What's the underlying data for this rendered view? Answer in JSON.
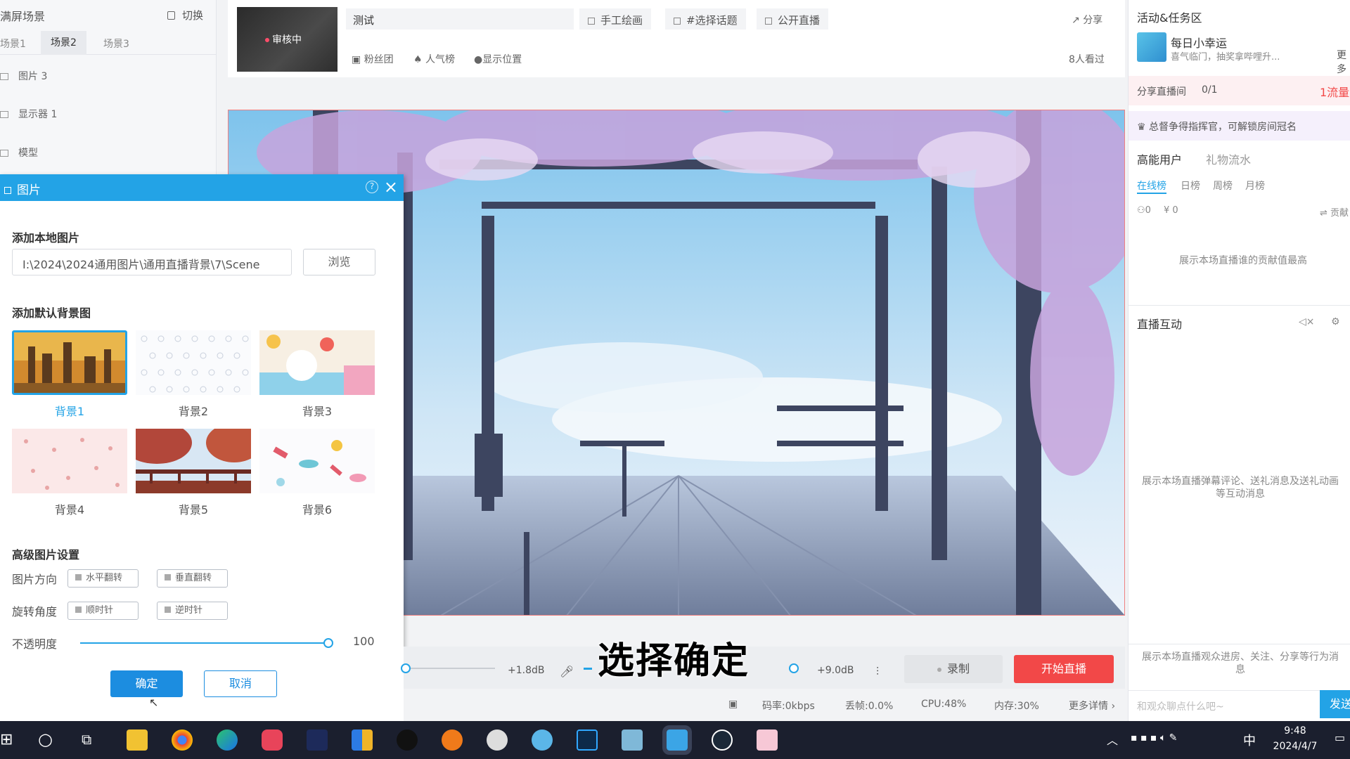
{
  "scene_panel": {
    "title": "满屏场景",
    "switch_label": "切换",
    "tabs": [
      "场景1",
      "场景2",
      "场景3"
    ],
    "sources": [
      "图片 3",
      "显示器 1",
      "模型"
    ]
  },
  "dialog": {
    "title": "图片",
    "add_local_heading": "添加本地图片",
    "path_value": "I:\\2024\\2024通用图片\\通用直播背景\\7\\Scene",
    "browse_label": "浏览",
    "default_bg_heading": "添加默认背景图",
    "thumbnails": [
      "背景1",
      "背景2",
      "背景3",
      "背景4",
      "背景5",
      "背景6"
    ],
    "advanced_heading": "高级图片设置",
    "direction_label": "图片方向",
    "flip_h": "水平翻转",
    "flip_v": "垂直翻转",
    "rotate_label": "旋转角度",
    "cw": "顺时针",
    "ccw": "逆时针",
    "opacity_label": "不透明度",
    "opacity_value": "100",
    "confirm_label": "确定",
    "cancel_label": "取消"
  },
  "topbar": {
    "cover_badge": "审核中",
    "room_title": "测试",
    "chips": [
      "手工绘画",
      "#选择话题",
      "公开直播"
    ],
    "share_label": "分享",
    "meta": [
      "粉丝团",
      "人气榜",
      "显示位置"
    ],
    "viewers": "8人看过"
  },
  "controls": {
    "mic_db": "+1.8dB",
    "speaker_db": "+9.0dB",
    "record_label": "录制",
    "start_label": "开始直播"
  },
  "status": {
    "bitrate": "码率:0kbps",
    "drop": "丢帧:0.0%",
    "cpu": "CPU:48%",
    "mem": "内存:30%",
    "more": "更多详情"
  },
  "subtitle": "选择确定",
  "right_panel": {
    "activity_title": "活动&任务区",
    "lucky_title": "每日小幸运",
    "lucky_sub": "喜气临门，抽奖拿哔哩升...",
    "more_label": "更多",
    "share_room": "分享直播间",
    "share_count": "0/1",
    "flow_label": "1流量",
    "crown_text": "总督争得指挥官，可解锁房间冠名",
    "tabs": [
      "高能用户",
      "礼物流水"
    ],
    "subtabs": [
      "在线榜",
      "日榜",
      "周榜",
      "月榜"
    ],
    "stat_people": "0",
    "stat_money": "¥ 0",
    "contrib": "贡献",
    "contrib_desc": "展示本场直播谁的贡献值最高",
    "interact_title": "直播互动",
    "interact_desc": "展示本场直播弹幕评论、送礼消息及送礼动画等互动消息",
    "audience_desc": "展示本场直播观众进房、关注、分享等行为消息",
    "chat_placeholder": "和观众聊点什么吧~",
    "send_label": "发送"
  },
  "taskbar": {
    "time": "9:48",
    "date": "2024/4/7",
    "ime": "中"
  }
}
